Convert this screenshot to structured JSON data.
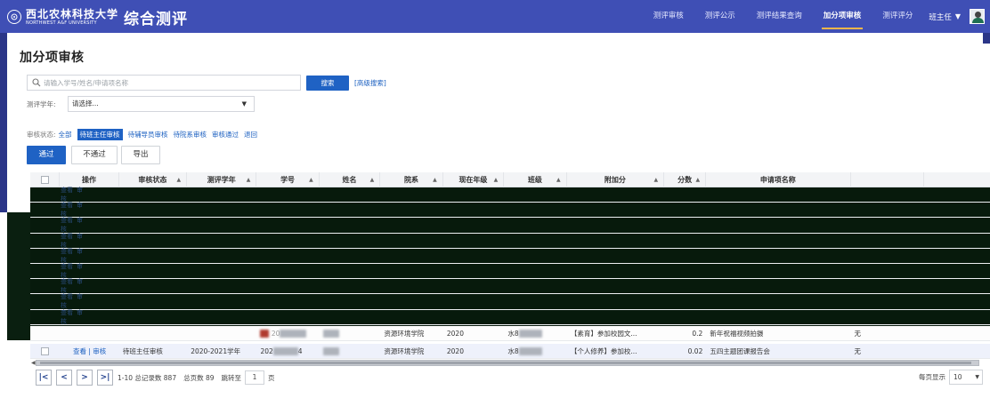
{
  "header": {
    "university_cn": "西北农林科技大学",
    "university_en": "NORTHWEST A&F UNIVERSITY",
    "app_title": "综合测评",
    "nav": [
      "测评审核",
      "测评公示",
      "测评结果查询",
      "加分项审核",
      "测评评分"
    ],
    "active_nav": "加分项审核",
    "role": "班主任"
  },
  "page": {
    "title": "加分项审核"
  },
  "search": {
    "placeholder": "请输入学号/姓名/申请项名称",
    "button": "搜索",
    "advanced": "[高级搜索]"
  },
  "year_filter": {
    "label": "测评学年:",
    "value": "请选择..."
  },
  "status_filter": {
    "label": "审核状态:",
    "options": [
      "全部",
      "待班主任审核",
      "待辅导员审核",
      "待院系审核",
      "审核通过",
      "退回"
    ],
    "selected": "待班主任审核"
  },
  "actions": {
    "pass": "通过",
    "reject": "不通过",
    "export": "导出"
  },
  "table": {
    "columns": [
      "操作",
      "审核状态",
      "测评学年",
      "学号",
      "姓名",
      "院系",
      "现在年级",
      "班级",
      "附加分",
      "分数",
      "申请项名称"
    ],
    "row_actions": {
      "view": "查看",
      "audit": "审核",
      "separator": "|"
    },
    "masked_row_actions": [
      "查看",
      "审核"
    ],
    "rows": [
      {
        "status": "",
        "year": "",
        "student_no": "20",
        "name": "",
        "college": "资源环境学院",
        "grade": "2020",
        "class": "水8",
        "bonus": "【素育】参加校园文...",
        "score": "0.2",
        "item": "新年祝福视频拍摄",
        "extra": "无"
      },
      {
        "status": "待班主任审核",
        "year": "2020-2021学年",
        "student_no": "202",
        "student_no_tail": "4",
        "name": "",
        "college": "资源环境学院",
        "grade": "2020",
        "class": "水8",
        "bonus": "【个人修养】参加校...",
        "score": "0.02",
        "item": "五四主题团课报告会",
        "extra": "无"
      }
    ]
  },
  "pagination": {
    "summary": "1-10 总记录数 887",
    "total_pages": "总页数 89",
    "jump_label": "跳转至",
    "current_page": "1",
    "page_suffix": "页",
    "page_size_label": "每页显示",
    "page_size": "10"
  },
  "colors": {
    "header": "#3f4fb5",
    "primary": "#1f62c4",
    "link": "#1a5fc0",
    "accent": "#f5b64a"
  }
}
